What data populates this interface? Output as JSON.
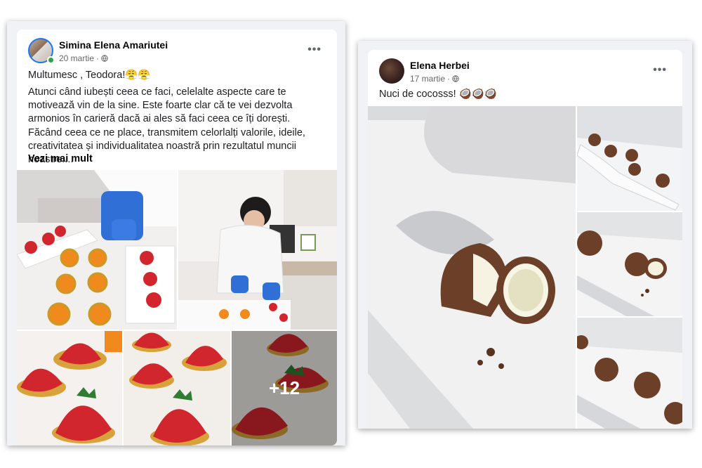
{
  "post1": {
    "author": "Simina Elena Amariutei",
    "date": "20 martie",
    "audience_icon": "globe-icon",
    "line1": "Multumesc , Teodora!😤😤",
    "paragraph1": "Atunci când iubești ceea ce faci, celelalte aspecte care te motivează vin de la sine. Este foarte clar că te vei dezvolta armonios în carieră dacă ai ales să faci ceea ce îți dorești.",
    "paragraph2": "Făcând ceea ce ne place, transmitem celorlalți valorile, ideile, creativitatea și individualitatea noastră prin rezultatul muncii noastre....",
    "see_more": "Vezi mai mult",
    "more_photos": "+12",
    "more_icon": "more-horizontal-icon"
  },
  "post2": {
    "author": "Elena Herbei",
    "date": "17 martie",
    "audience_icon": "globe-icon",
    "line1": "Nuci de cocosss! 🥥🥥🥥",
    "more_icon": "more-horizontal-icon"
  },
  "colors": {
    "accent": "#1877f2",
    "online": "#31a24c",
    "meta_text": "#65676b",
    "strawberry": "#d1262e",
    "orange_dessert": "#f08a1c",
    "coconut": "#6b3f28"
  }
}
